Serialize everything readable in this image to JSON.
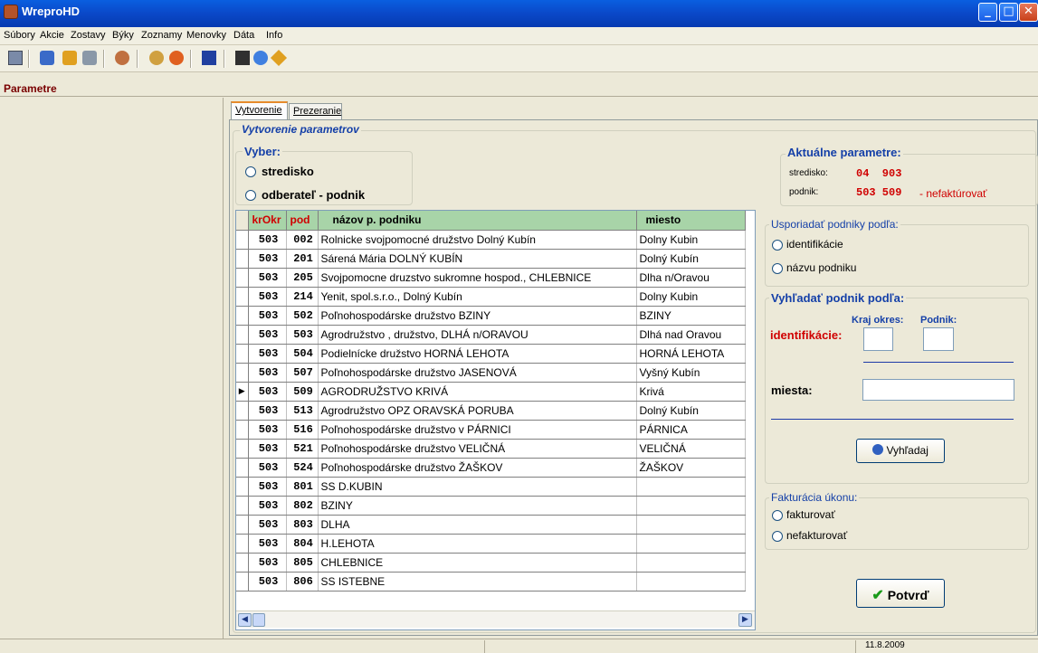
{
  "window": {
    "title": "WreproHD"
  },
  "menu": [
    "Súbory",
    "Akcie",
    "Zostavy",
    "Býky",
    "Zoznamy",
    "Menovky",
    "Dáta",
    "Info"
  ],
  "panel_title": "Parametre",
  "tabs": [
    {
      "label": "Vytvorenie",
      "active": true
    },
    {
      "label": "Prezeranie",
      "active": false
    }
  ],
  "section_title": "Vytvorenie parametrov",
  "vyber": {
    "title": "Vyber:",
    "options": [
      "stredisko",
      "odberateľ - podnik"
    ]
  },
  "aktualne": {
    "title": "Aktuálne parametre:",
    "stredisko_label": "stredisko:",
    "stredisko_value": "04  903",
    "podnik_label": "podnik:",
    "podnik_value": "503 509",
    "podnik_note": "- nefaktúrovať"
  },
  "grid": {
    "columns": [
      "krOkr",
      "pod",
      "názov p. podniku",
      "miesto"
    ],
    "selected_index": 8,
    "rows": [
      [
        "503",
        "002",
        "Rolnicke svojpomocné družstvo Dolný Kubín",
        "Dolny Kubin"
      ],
      [
        "503",
        "201",
        "Sárená Mária DOLNÝ KUBÍN",
        "Dolný Kubín"
      ],
      [
        "503",
        "205",
        "Svojpomocne druzstvo sukromne hospod., CHLEBNICE",
        "Dlha n/Oravou"
      ],
      [
        "503",
        "214",
        "Yenit, spol.s.r.o., Dolný Kubín",
        "Dolny Kubin"
      ],
      [
        "503",
        "502",
        "Poľnohospodárske družstvo BZINY",
        "BZINY"
      ],
      [
        "503",
        "503",
        "Agrodružstvo , družstvo, DLHÁ n/ORAVOU",
        "Dlhá nad Oravou"
      ],
      [
        "503",
        "504",
        "Podielnícke družstvo HORNÁ LEHOTA",
        "HORNÁ LEHOTA"
      ],
      [
        "503",
        "507",
        "Poľnohospodárske družstvo JASENOVÁ",
        "Vyšný Kubín"
      ],
      [
        "503",
        "509",
        "AGRODRUŽSTVO KRIVÁ",
        "Krivá"
      ],
      [
        "503",
        "513",
        "Agrodružstvo OPZ ORAVSKÁ PORUBA",
        "Dolný Kubín"
      ],
      [
        "503",
        "516",
        "Poľnohospodárske družstvo v PÁRNICI",
        "PÁRNICA"
      ],
      [
        "503",
        "521",
        "Poľnohospodárske družstvo VELIČNÁ",
        "VELIČNÁ"
      ],
      [
        "503",
        "524",
        "Poľnohospodárske družstvo ŽAŠKOV",
        "ŽAŠKOV"
      ],
      [
        "503",
        "801",
        "SS D.KUBIN",
        ""
      ],
      [
        "503",
        "802",
        "BZINY",
        ""
      ],
      [
        "503",
        "803",
        "DLHA",
        ""
      ],
      [
        "503",
        "804",
        "H.LEHOTA",
        ""
      ],
      [
        "503",
        "805",
        "CHLEBNICE",
        ""
      ],
      [
        "503",
        "806",
        "SS ISTEBNE",
        ""
      ]
    ]
  },
  "usporiadat": {
    "title": "Usporiadať podniky podľa:",
    "options": [
      "identifikácie",
      "názvu podniku"
    ]
  },
  "vyhladat": {
    "title": "Vyhľadať podnik podľa:",
    "kraj_label": "Kraj okres:",
    "podnik_label": "Podnik:",
    "identifikacie_label": "identifikácie:",
    "miesta_label": "miesta:",
    "button": "Vyhľadaj"
  },
  "fakturacia": {
    "title": "Fakturácia úkonu:",
    "options": [
      "fakturovať",
      "nefakturovať"
    ]
  },
  "confirm_button": "Potvrď",
  "status": {
    "date": "11.8.2009"
  },
  "colors": {
    "accent_red": "#d00000",
    "group_blue": "#1540a8",
    "grid_header": "#a8d4a8"
  }
}
